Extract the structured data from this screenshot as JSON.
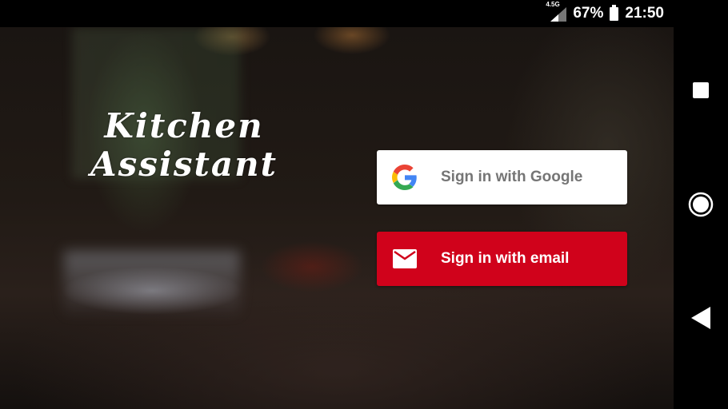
{
  "status_bar": {
    "network_type": "4.5G",
    "battery_percent": "67%",
    "time": "21:50"
  },
  "app": {
    "title_line1": "Kitchen",
    "title_line2": "Assistant",
    "google_button_label": "Sign in with Google",
    "email_button_label": "Sign in with email",
    "colors": {
      "google_button_bg": "#ffffff",
      "email_button_bg": "#d0021b"
    }
  },
  "nav_bar": {
    "icons": [
      "recents-icon",
      "home-icon",
      "back-icon"
    ]
  }
}
